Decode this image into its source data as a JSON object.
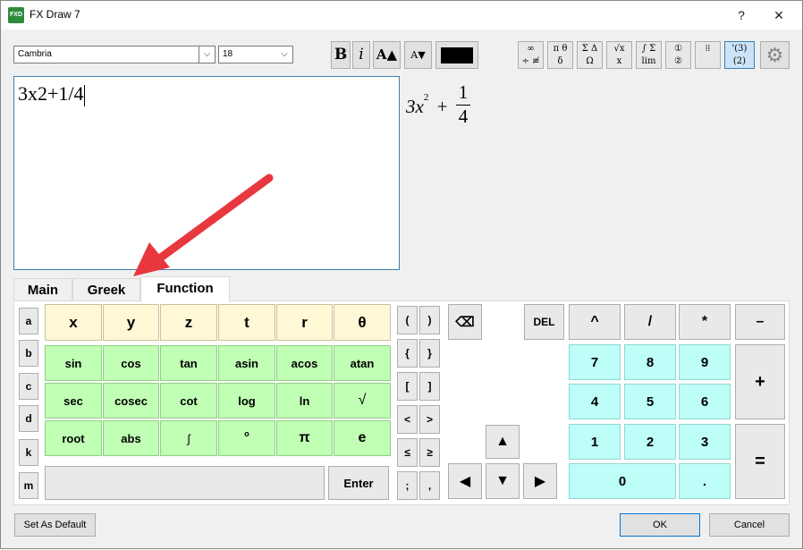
{
  "window": {
    "title": "FX Draw 7",
    "help_label": "?",
    "close_label": "✕",
    "app_icon_text": "FXD"
  },
  "toolbar": {
    "font_family": "Cambria",
    "font_size": "18",
    "bold_label": "B",
    "italic_label": "i",
    "grow_label": "A▲",
    "shrink_label": "A▼",
    "text_color": "#000000",
    "symbol_buttons": [
      {
        "top": "∞",
        "bottom": "÷ ≢"
      },
      {
        "top": "π θ",
        "bottom": "δ"
      },
      {
        "top": "Σ Δ",
        "bottom": "Ω"
      },
      {
        "top": "√x",
        "bottom": "x"
      },
      {
        "top": "∫ Σ",
        "bottom": "lim"
      },
      {
        "top": "①",
        "bottom": "②"
      },
      {
        "top": "⁞⁞",
        "bottom": ""
      },
      {
        "top": "'(3)",
        "bottom": "(2)"
      }
    ]
  },
  "editor": {
    "text": "3x2+1/4"
  },
  "preview": {
    "base": "3x",
    "exponent": "2",
    "plus": "+",
    "numerator": "1",
    "denominator": "4"
  },
  "tabs": [
    "Main",
    "Greek",
    "Function"
  ],
  "keypad": {
    "side_keys": [
      "a",
      "b",
      "c",
      "d",
      "k",
      "m"
    ],
    "variables": [
      "x",
      "y",
      "z",
      "t",
      "r",
      "θ"
    ],
    "functions_row1": [
      "sin",
      "cos",
      "tan",
      "asin",
      "acos",
      "atan"
    ],
    "functions_row2": [
      "sec",
      "cosec",
      "cot",
      "log",
      "ln",
      "√"
    ],
    "functions_row3": [
      "root",
      "abs",
      "∫",
      "°",
      "π",
      "e"
    ],
    "enter_label": "Enter",
    "brackets": [
      [
        "(",
        ")"
      ],
      [
        "{",
        "}"
      ],
      [
        "[",
        "]"
      ],
      [
        "<",
        ">"
      ],
      [
        "≤",
        "≥"
      ],
      [
        ";",
        ","
      ]
    ],
    "backspace_label": "⌫",
    "del_label": "DEL",
    "operators": {
      "power": "^",
      "divide": "/",
      "multiply": "*",
      "minus": "–",
      "plus": "+",
      "equals": "="
    },
    "digits": [
      [
        "7",
        "8",
        "9"
      ],
      [
        "4",
        "5",
        "6"
      ],
      [
        "1",
        "2",
        "3"
      ]
    ],
    "zero": "0",
    "decimal": ".",
    "arrows": {
      "up": "▲",
      "left": "◀",
      "down": "▼",
      "right": "▶"
    }
  },
  "footer": {
    "set_default_label": "Set As Default",
    "ok_label": "OK",
    "cancel_label": "Cancel"
  },
  "colors": {
    "variable_key": "#fff8d6",
    "function_key": "#c0ffb4",
    "number_key": "#bdfff8",
    "annotation_arrow": "#e8373f"
  }
}
